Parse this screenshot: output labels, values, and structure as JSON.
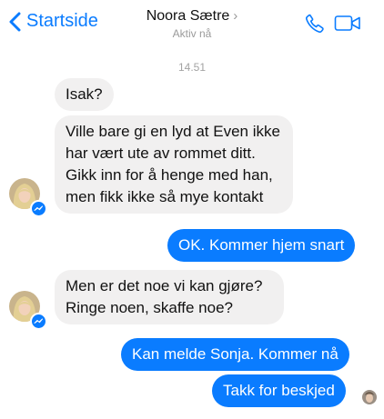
{
  "header": {
    "back_label": "Startside",
    "contact_name": "Noora Sætre",
    "status": "Aktiv nå",
    "accent": "#0a7cff"
  },
  "conversation": {
    "timestamp": "14.51",
    "messages": [
      {
        "from": "contact",
        "text": "Isak?"
      },
      {
        "from": "contact",
        "text": "Ville bare gi en lyd at Even ikke har vært ute av rommet ditt. Gikk inn for å henge med han, men fikk ikke så mye kontakt"
      },
      {
        "from": "me",
        "text": "OK. Kommer hjem snart"
      },
      {
        "from": "contact",
        "text": "Men er det noe vi kan gjøre? Ringe noen, skaffe noe?"
      },
      {
        "from": "me",
        "text": "Kan melde Sonja. Kommer nå"
      },
      {
        "from": "me",
        "text": "Takk for beskjed"
      }
    ]
  },
  "icons": {
    "back": "chevron-left-icon",
    "call": "phone-icon",
    "video": "video-camera-icon",
    "messenger": "messenger-badge-icon"
  }
}
